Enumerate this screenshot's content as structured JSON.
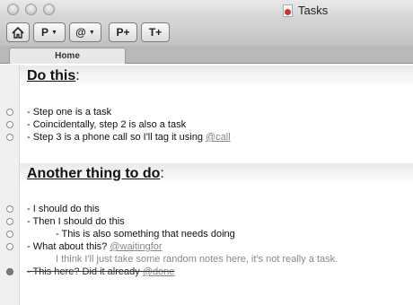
{
  "window": {
    "title": "Tasks"
  },
  "toolbar": {
    "project_label": "P",
    "context_label": "@",
    "new_project_label": "P+",
    "new_task_label": "T+"
  },
  "tabs": [
    {
      "label": "Home"
    }
  ],
  "sections": [
    {
      "title": "Do this",
      "items": [
        {
          "text": "- Step one is a task"
        },
        {
          "text": "- Coincidentally, step 2 is also a task"
        },
        {
          "text": "- Step 3 is a phone call so I'll tag it using ",
          "tag": "@call"
        }
      ]
    },
    {
      "title": "Another thing to do",
      "items": [
        {
          "text": "- I should do this"
        },
        {
          "text": "- Then I should do this"
        },
        {
          "text": "- This is also something that needs doing"
        },
        {
          "text": "- What about this? ",
          "tag": "@waitingfor"
        },
        {
          "text": "I think I'll just take some random notes here, it's not really a task."
        },
        {
          "text": "- This here? Did it already ",
          "tag": "@done"
        }
      ]
    }
  ]
}
